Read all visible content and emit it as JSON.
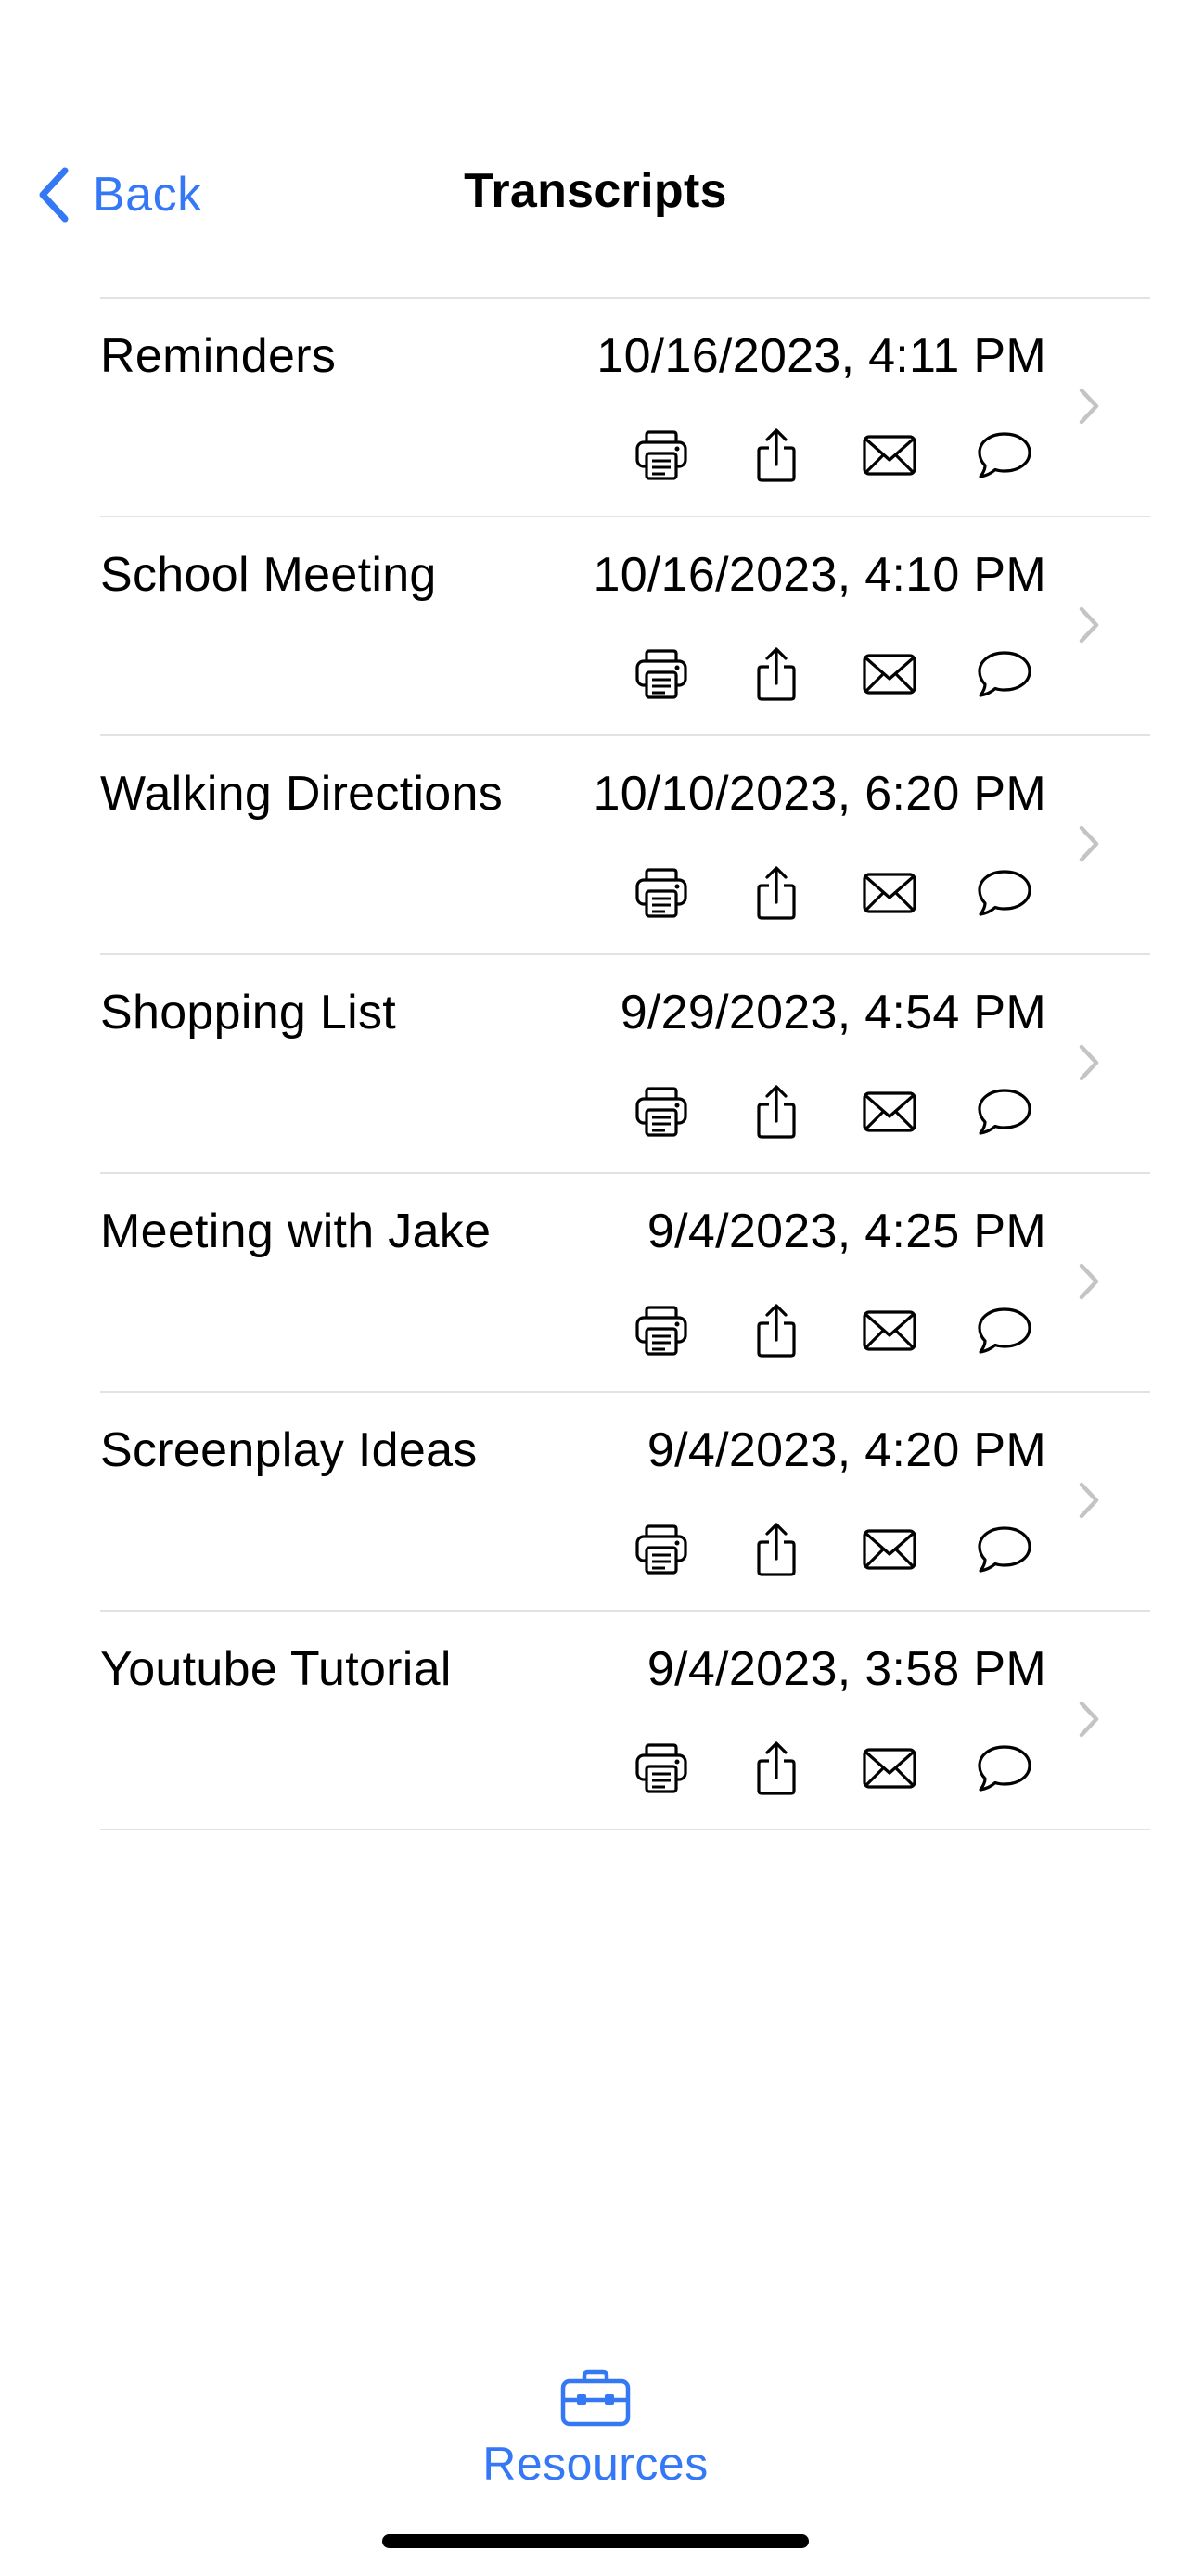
{
  "nav": {
    "back_label": "Back",
    "title": "Transcripts"
  },
  "transcripts": [
    {
      "title": "Reminders",
      "date": "10/16/2023, 4:11 PM"
    },
    {
      "title": "School Meeting",
      "date": "10/16/2023, 4:10 PM"
    },
    {
      "title": "Walking Directions",
      "date": "10/10/2023, 6:20 PM"
    },
    {
      "title": "Shopping List",
      "date": "9/29/2023, 4:54 PM"
    },
    {
      "title": "Meeting with Jake",
      "date": "9/4/2023, 4:25 PM"
    },
    {
      "title": "Screenplay Ideas",
      "date": "9/4/2023, 4:20 PM"
    },
    {
      "title": "Youtube Tutorial",
      "date": "9/4/2023, 3:58 PM"
    }
  ],
  "row_actions": [
    "printer-icon",
    "share-icon",
    "mail-icon",
    "message-bubble-icon"
  ],
  "tab_bar": {
    "items": [
      {
        "label": "Resources",
        "icon": "briefcase-icon",
        "selected": true
      }
    ]
  },
  "colors": {
    "accent": "#3478f6",
    "separator": "#e2e2e6",
    "chevron": "#c4c4c7",
    "text": "#000000"
  }
}
